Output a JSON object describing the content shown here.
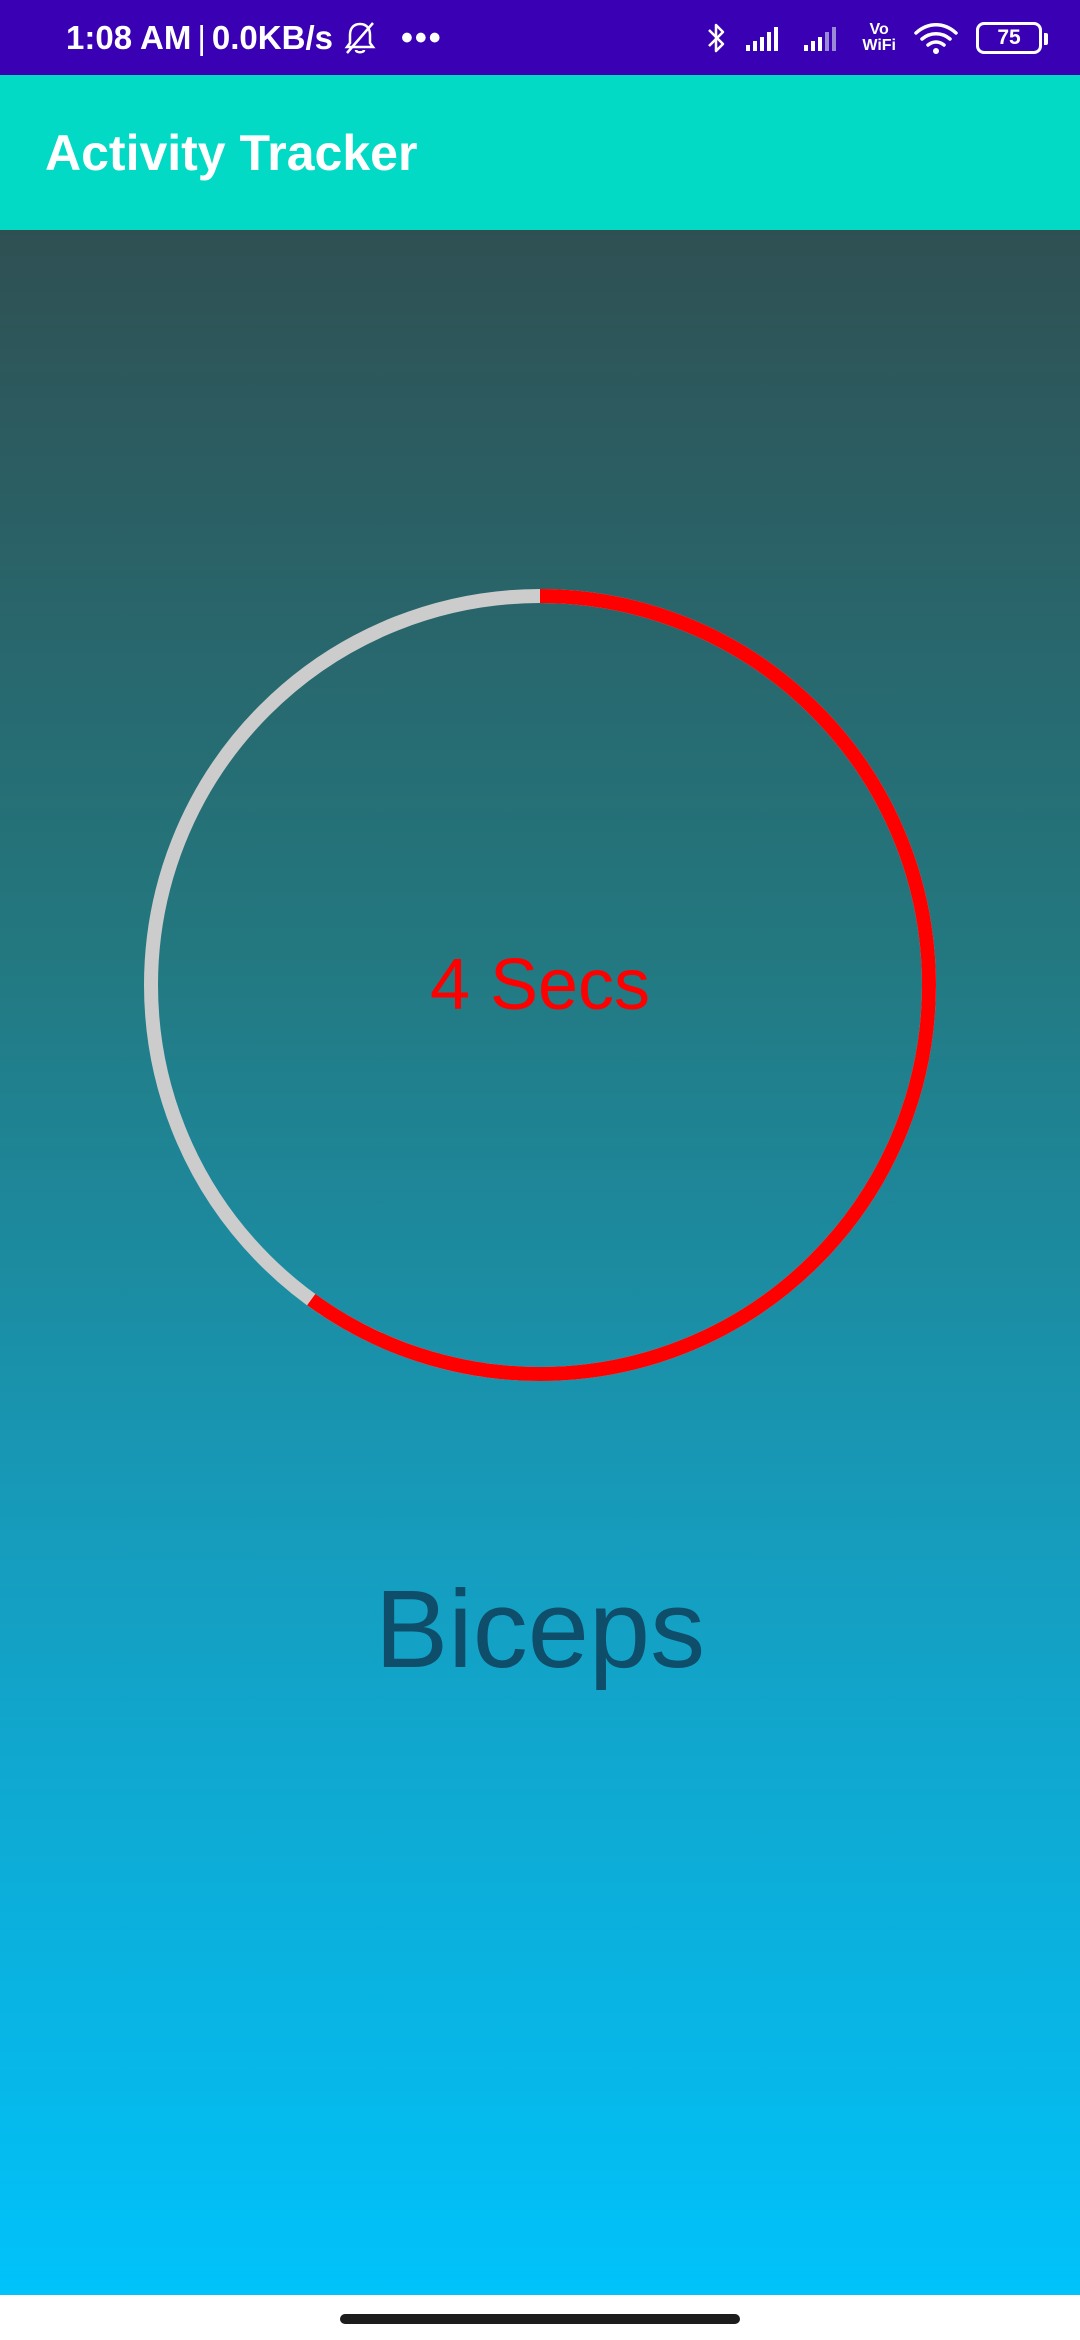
{
  "status_bar": {
    "time": "1:08 AM",
    "separator": "|",
    "net_speed": "0.0KB/s",
    "vowifi_top": "Vo",
    "vowifi_bottom": "WiFi",
    "battery": "75",
    "icons": [
      "bell-off-icon",
      "more-dots-icon",
      "bluetooth-icon",
      "signal-icon",
      "signal-icon",
      "vowifi-icon",
      "wifi-icon",
      "battery-icon"
    ]
  },
  "app_bar": {
    "title": "Activity Tracker"
  },
  "timer": {
    "label": "4 Secs",
    "progress_fraction": 0.6,
    "progress_color": "#ff0000",
    "track_color": "#cccccc"
  },
  "exercise": {
    "name": "Biceps"
  },
  "colors": {
    "status_bar": "#3a00b4",
    "app_bar": "#03dac5",
    "gradient_top": "#2f5053",
    "gradient_bottom": "#00c3fb",
    "exercise_text": "#0e4e6a"
  }
}
